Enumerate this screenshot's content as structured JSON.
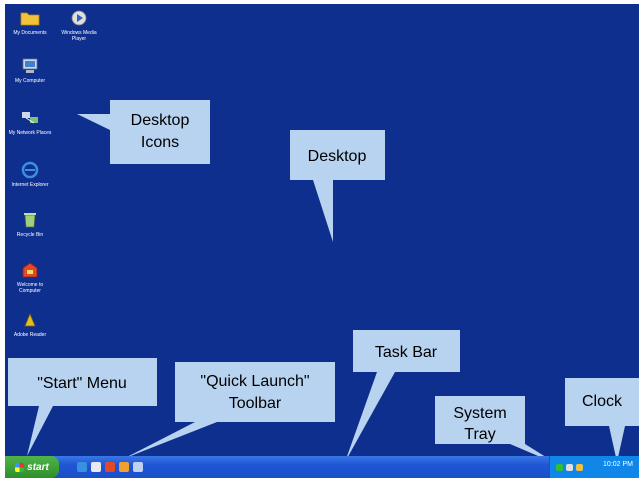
{
  "desktop_icons": [
    {
      "name": "my-documents",
      "label": "My Documents",
      "icon": "folder-icon",
      "color": "#f2c23c"
    },
    {
      "name": "windows-media-player",
      "label": "Windows Media Player",
      "icon": "media-player-icon",
      "color": "#e0e0e0"
    },
    {
      "name": "my-computer",
      "label": "My Computer",
      "icon": "computer-icon",
      "color": "#cfd8e8"
    },
    {
      "name": "my-network-places",
      "label": "My Network Places",
      "icon": "network-icon",
      "color": "#7fc07f"
    },
    {
      "name": "internet-explorer",
      "label": "Internet Explorer",
      "icon": "internet-explorer-icon",
      "color": "#3a8fe0"
    },
    {
      "name": "recycle-bin",
      "label": "Recycle Bin",
      "icon": "recycle-bin-icon",
      "color": "#9fd07f"
    },
    {
      "name": "welcome",
      "label": "Welcome to Computer",
      "icon": "welcome-icon",
      "color": "#e04a2a"
    },
    {
      "name": "adobe",
      "label": "Adobe Reader",
      "icon": "adobe-icon",
      "color": "#e0c020"
    }
  ],
  "callouts": {
    "desktop_icons": [
      "Desktop",
      "Icons"
    ],
    "desktop": "Desktop",
    "start_menu": "\"Start\" Menu",
    "quick_launch": [
      "\"Quick Launch\"",
      "Toolbar"
    ],
    "task_bar": "Task Bar",
    "system_tray": [
      "System",
      "Tray"
    ],
    "clock": "Clock"
  },
  "taskbar": {
    "start_label": "start",
    "quick_launch_icons": [
      "ie-icon",
      "outlook-icon",
      "media-icon",
      "desktop-icon",
      "explorer-icon"
    ],
    "clock_text": "10:02 PM"
  },
  "colors": {
    "desktop": "#0f2f8f",
    "callout": "#b7d3f0",
    "taskbar": "#1f56d4",
    "start_button": "#2f8f2b",
    "tray": "#0f86e8"
  }
}
